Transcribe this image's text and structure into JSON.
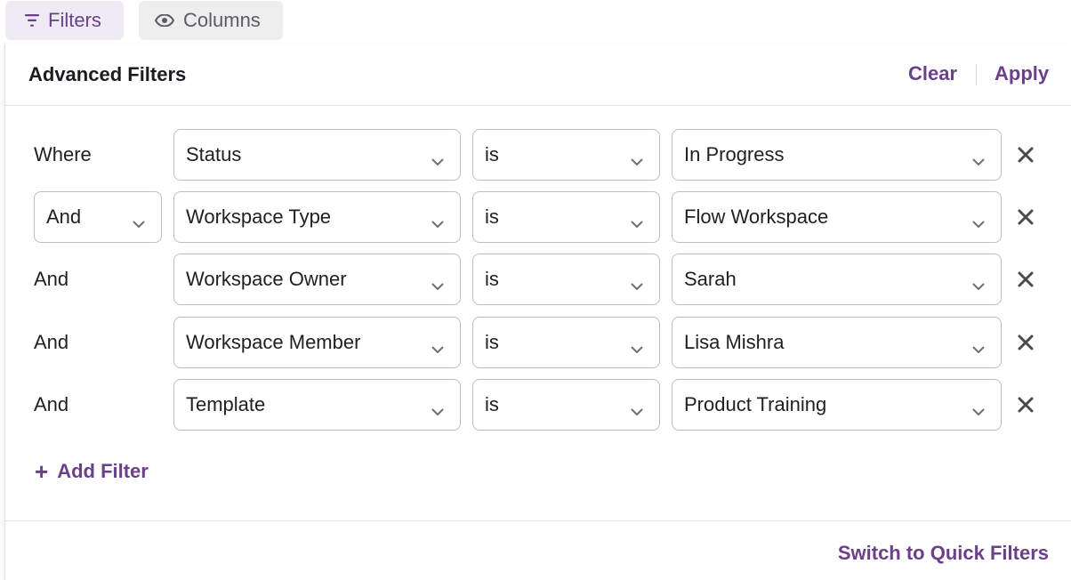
{
  "toolbar": {
    "filters_label": "Filters",
    "columns_label": "Columns"
  },
  "panel": {
    "title": "Advanced Filters",
    "clear_label": "Clear",
    "apply_label": "Apply",
    "add_filter_label": "Add Filter",
    "switch_label": "Switch to Quick Filters"
  },
  "rows": [
    {
      "conjunction": "Where",
      "conjunction_is_select": false,
      "field": "Status",
      "operator": "is",
      "value": "In Progress"
    },
    {
      "conjunction": "And",
      "conjunction_is_select": true,
      "field": "Workspace Type",
      "operator": "is",
      "value": "Flow Workspace"
    },
    {
      "conjunction": "And",
      "conjunction_is_select": false,
      "field": "Workspace Owner",
      "operator": "is",
      "value": "Sarah"
    },
    {
      "conjunction": "And",
      "conjunction_is_select": false,
      "field": "Workspace Member",
      "operator": "is",
      "value": "Lisa Mishra"
    },
    {
      "conjunction": "And",
      "conjunction_is_select": false,
      "field": "Template",
      "operator": "is",
      "value": "Product Training"
    }
  ],
  "colors": {
    "accent": "#6b3f8a",
    "filters_bg": "#efebf5",
    "columns_bg": "#eeeeee",
    "border": "#bdbdc3"
  },
  "icons": {
    "filters": "filter-lines-icon",
    "columns": "eye-icon",
    "dropdown": "chevron-down-icon",
    "remove": "close-icon",
    "add": "plus-icon"
  }
}
